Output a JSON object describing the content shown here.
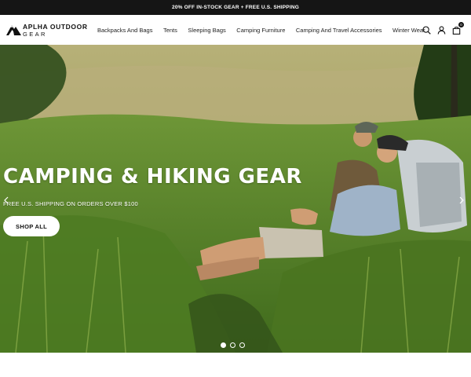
{
  "announcement": {
    "text": "20% OFF IN-STOCK GEAR + FREE U.S. SHIPPING"
  },
  "brand": {
    "name_line1": "APLHA OUTDOOR",
    "name_line2": "GEAR"
  },
  "nav": {
    "items": [
      {
        "label": "Backpacks And Bags"
      },
      {
        "label": "Tents"
      },
      {
        "label": "Sleeping Bags"
      },
      {
        "label": "Camping Furniture"
      },
      {
        "label": "Camping And Travel Accessories"
      },
      {
        "label": "Winter Wear"
      }
    ]
  },
  "header_icons": {
    "search": "search-icon",
    "account": "user-icon",
    "cart": "bag-icon",
    "cart_count": "0"
  },
  "hero": {
    "title": "CAMPING & HIKING GEAR",
    "subtitle": "FREE U.S. SHIPPING ON ORDERS OVER $100",
    "cta_label": "SHOP ALL",
    "slides_total": 3,
    "active_slide": 1
  },
  "colors": {
    "announcement_bg": "#151515",
    "button_bg": "#ffffff",
    "text_dark": "#111111"
  }
}
